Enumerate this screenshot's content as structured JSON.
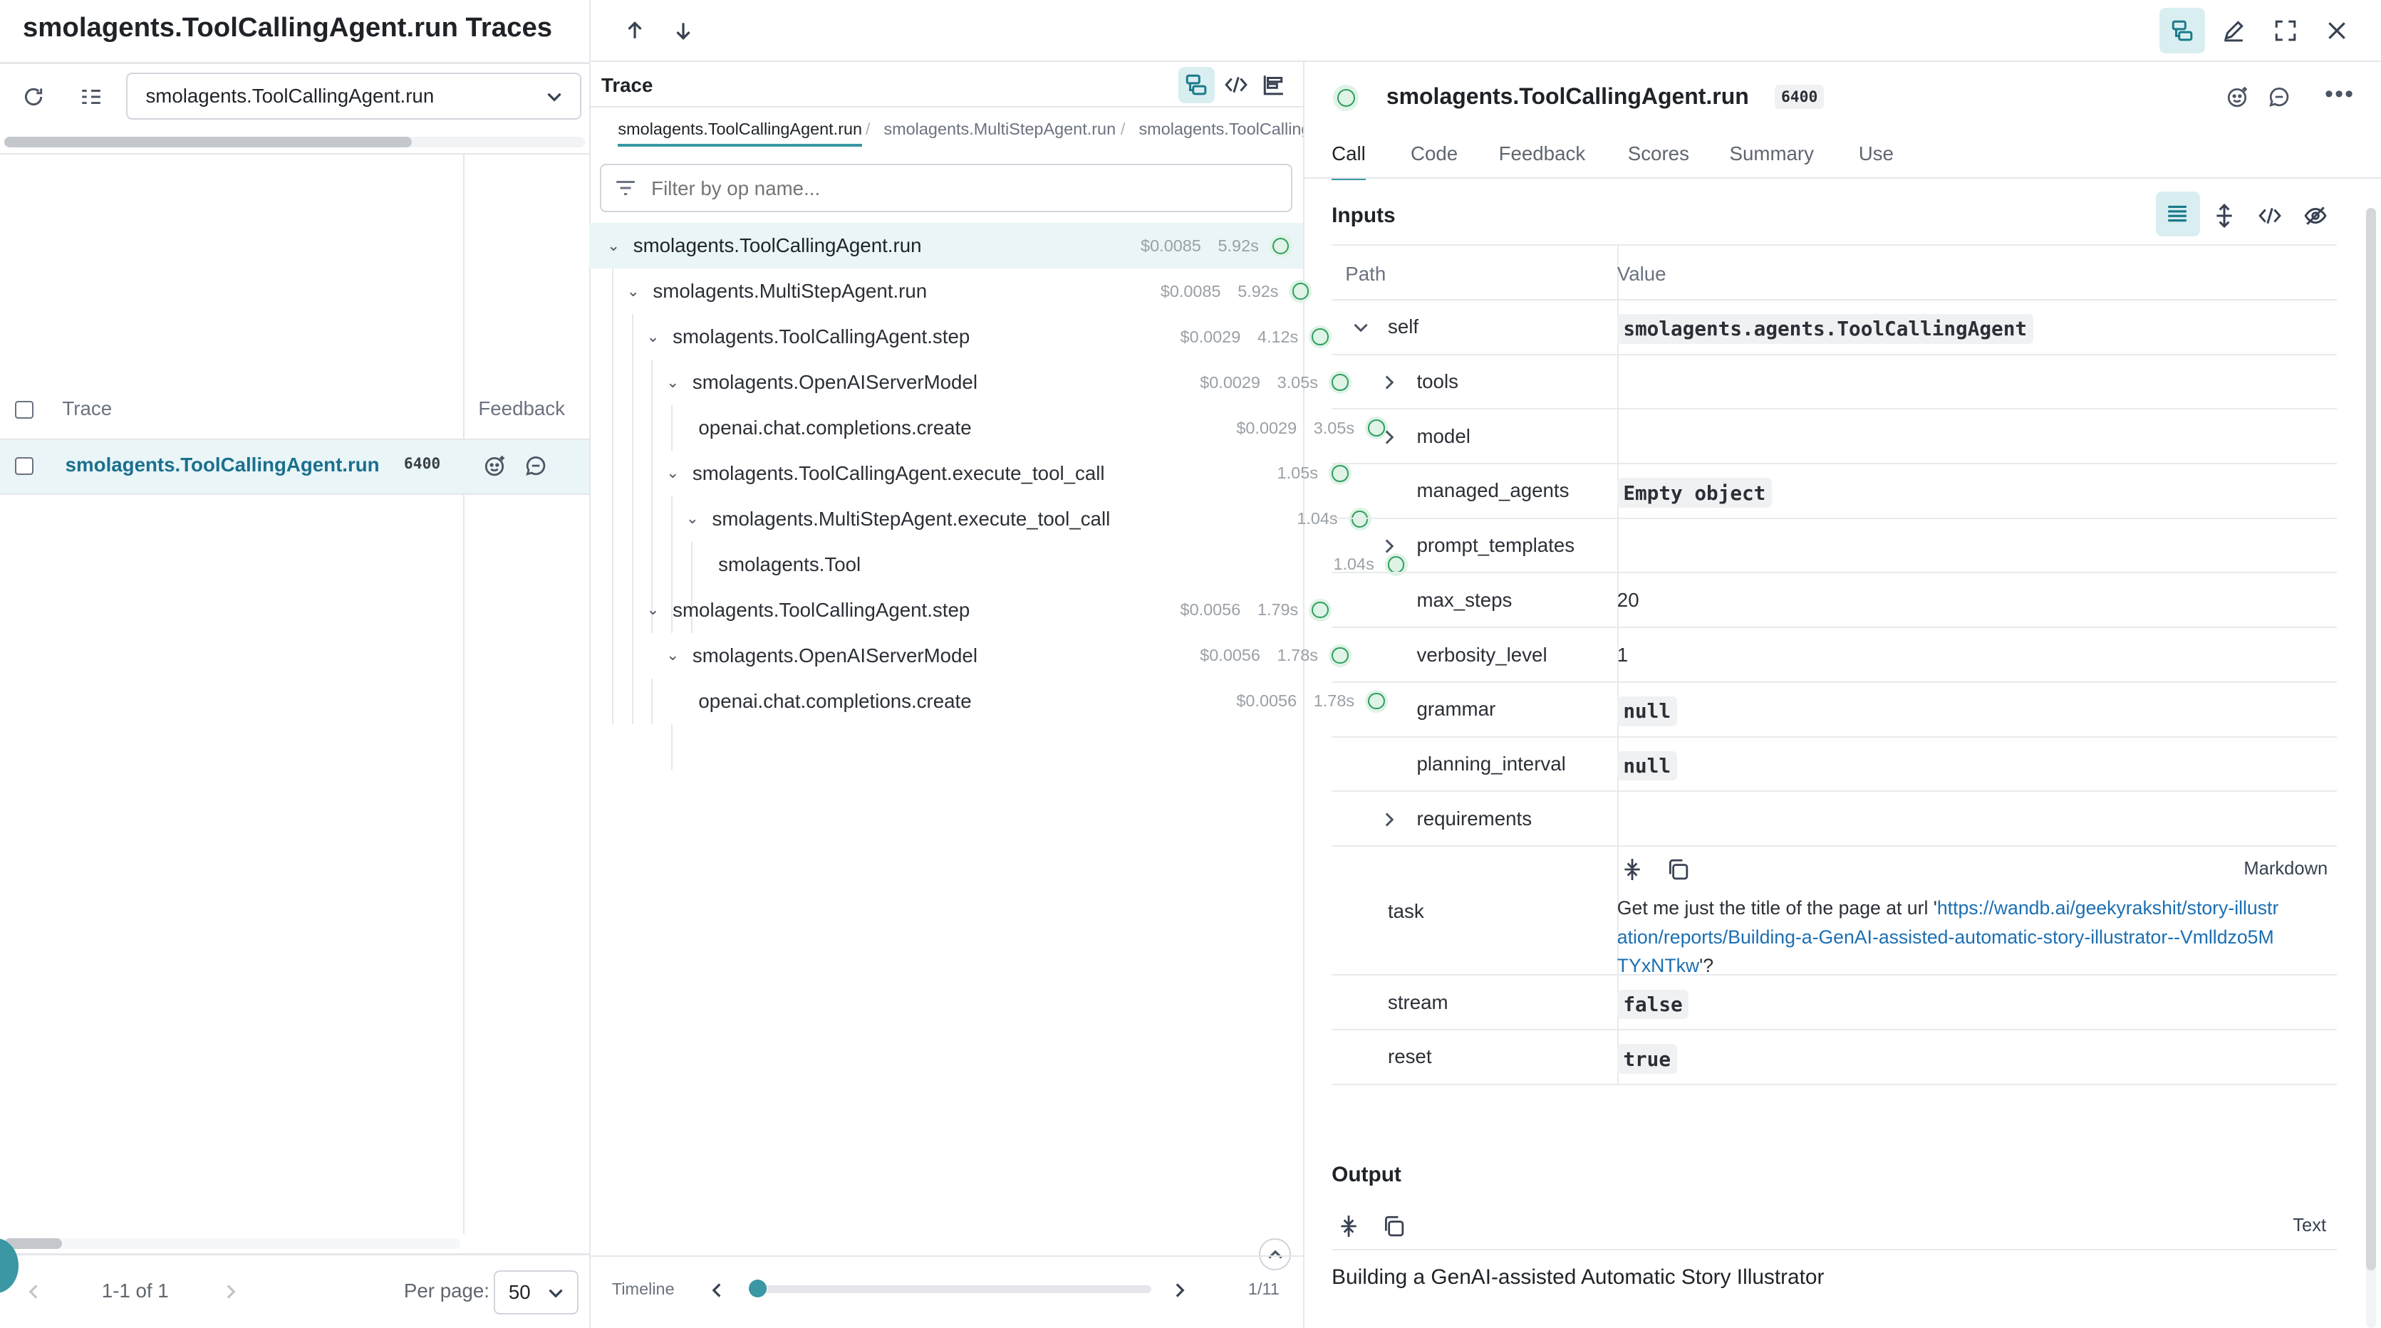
{
  "left": {
    "title": "smolagents.ToolCallingAgent.run Traces",
    "op_filter_value": "smolagents.ToolCallingAgent.run",
    "columns": {
      "trace": "Trace",
      "feedback": "Feedback"
    },
    "rows": [
      {
        "name": "smolagents.ToolCallingAgent.run",
        "tokens": "6400"
      }
    ],
    "pagination": {
      "range": "1-1 of 1",
      "per_page_label": "Per page:",
      "per_page_value": "50"
    }
  },
  "trace": {
    "title": "Trace",
    "breadcrumbs": [
      "smolagents.ToolCallingAgent.run",
      "smolagents.MultiStepAgent.run",
      "smolagents.ToolCalling"
    ],
    "filter_placeholder": "Filter by op name...",
    "nodes": [
      {
        "name": "smolagents.ToolCallingAgent.run",
        "cost": "$0.0085",
        "duration": "5.92s"
      },
      {
        "name": "smolagents.MultiStepAgent.run",
        "cost": "$0.0085",
        "duration": "5.92s"
      },
      {
        "name": "smolagents.ToolCallingAgent.step",
        "cost": "$0.0029",
        "duration": "4.12s"
      },
      {
        "name": "smolagents.OpenAIServerModel",
        "cost": "$0.0029",
        "duration": "3.05s"
      },
      {
        "name": "openai.chat.completions.create",
        "cost": "$0.0029",
        "duration": "3.05s"
      },
      {
        "name": "smolagents.ToolCallingAgent.execute_tool_call",
        "cost": "",
        "duration": "1.05s"
      },
      {
        "name": "smolagents.MultiStepAgent.execute_tool_call",
        "cost": "",
        "duration": "1.04s"
      },
      {
        "name": "smolagents.Tool",
        "cost": "",
        "duration": "1.04s"
      },
      {
        "name": "smolagents.ToolCallingAgent.step",
        "cost": "$0.0056",
        "duration": "1.79s"
      },
      {
        "name": "smolagents.OpenAIServerModel",
        "cost": "$0.0056",
        "duration": "1.78s"
      },
      {
        "name": "openai.chat.completions.create",
        "cost": "$0.0056",
        "duration": "1.78s"
      }
    ],
    "timeline": {
      "label": "Timeline",
      "position": "1/11"
    }
  },
  "call": {
    "title": "smolagents.ToolCallingAgent.run",
    "tokens": "6400",
    "tabs": [
      "Call",
      "Code",
      "Feedback",
      "Scores",
      "Summary",
      "Use"
    ],
    "inputs_title": "Inputs",
    "columns": {
      "path": "Path",
      "value": "Value"
    },
    "self": {
      "key": "self",
      "value": "smolagents.agents.ToolCallingAgent"
    },
    "self_fields": [
      {
        "key": "tools",
        "value": ""
      },
      {
        "key": "model",
        "value": ""
      },
      {
        "key": "managed_agents",
        "value": "Empty object"
      },
      {
        "key": "prompt_templates",
        "value": ""
      },
      {
        "key": "max_steps",
        "value": "20"
      },
      {
        "key": "verbosity_level",
        "value": "1"
      },
      {
        "key": "grammar",
        "value": "null"
      },
      {
        "key": "planning_interval",
        "value": "null"
      },
      {
        "key": "requirements",
        "value": ""
      }
    ],
    "task": {
      "key": "task",
      "format": "Markdown",
      "prefix": "Get me just the title of the page at url '",
      "link": "https://wandb.ai/geekyrakshit/story-illustration/reports/Building-a-GenAI-assisted-automatic-story-illustrator--Vmlldzo5MTYxNTkw",
      "suffix": "'?"
    },
    "stream": {
      "key": "stream",
      "value": "false"
    },
    "reset": {
      "key": "reset",
      "value": "true"
    },
    "output_title": "Output",
    "output_format": "Text",
    "output_value": "Building a GenAI-assisted Automatic Story Illustrator"
  }
}
